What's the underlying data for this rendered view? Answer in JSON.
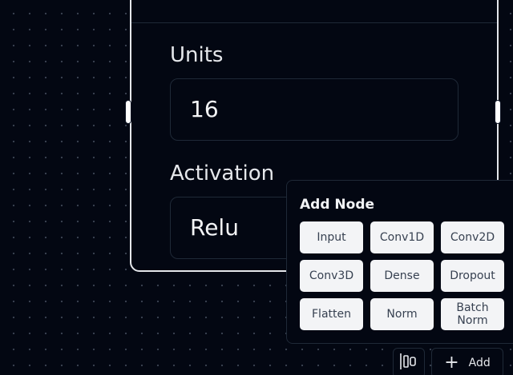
{
  "node": {
    "fields": [
      {
        "label": "Units",
        "value": "16"
      },
      {
        "label": "Activation",
        "value": "Relu"
      }
    ]
  },
  "add_panel": {
    "title": "Add Node",
    "buttons": [
      "Input",
      "Conv1D",
      "Conv2D",
      "Conv3D",
      "Dense",
      "Dropout",
      "Flatten",
      "Norm",
      "Batch Norm"
    ]
  },
  "toolbar": {
    "layout_icon": "align-icon",
    "add_icon": "plus-icon",
    "add_label": "Add"
  },
  "colors": {
    "background": "#030712",
    "node_border": "#e5e7eb",
    "button_bg": "#f3f4f6",
    "button_text": "#374151"
  }
}
